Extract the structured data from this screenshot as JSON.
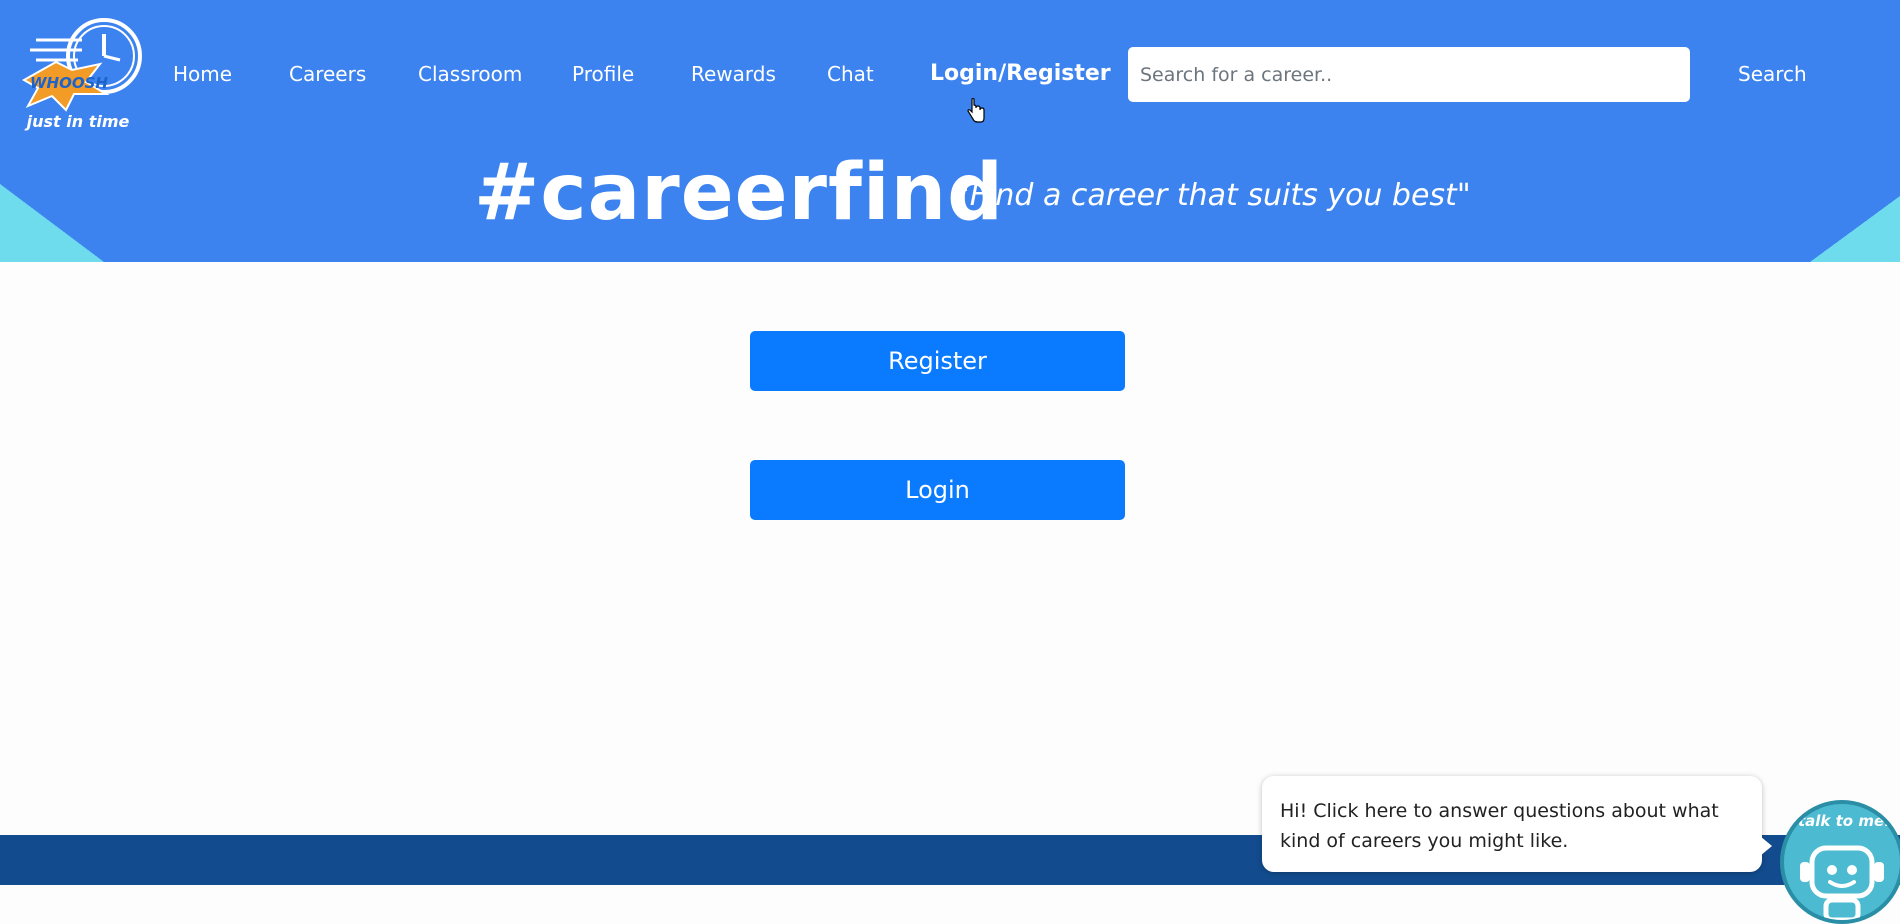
{
  "logo": {
    "tagline": "just in time",
    "icon": "whoosh-clock-logo"
  },
  "nav": {
    "items": [
      {
        "label": "Home"
      },
      {
        "label": "Careers"
      },
      {
        "label": "Classroom"
      },
      {
        "label": "Profile"
      },
      {
        "label": "Rewards"
      },
      {
        "label": "Chat"
      },
      {
        "label": "Login/Register"
      }
    ],
    "active": "Login/Register"
  },
  "search": {
    "placeholder": "Search for a career..",
    "value": "",
    "button_label": "Search"
  },
  "hero": {
    "hashtag": "#careerfind",
    "tagline": "\"Find a career that suits you best\""
  },
  "auth": {
    "register_label": "Register",
    "login_label": "Login"
  },
  "chatbot": {
    "bubble_text": "Hi! Click here to answer questions about what kind of careers you might like.",
    "avatar_label": "talk to me!",
    "icon": "robot-icon"
  },
  "colors": {
    "header": "#3c83f0",
    "accent_triangle": "#6fdcee",
    "button": "#0a7bff",
    "footer": "#124c8e"
  }
}
